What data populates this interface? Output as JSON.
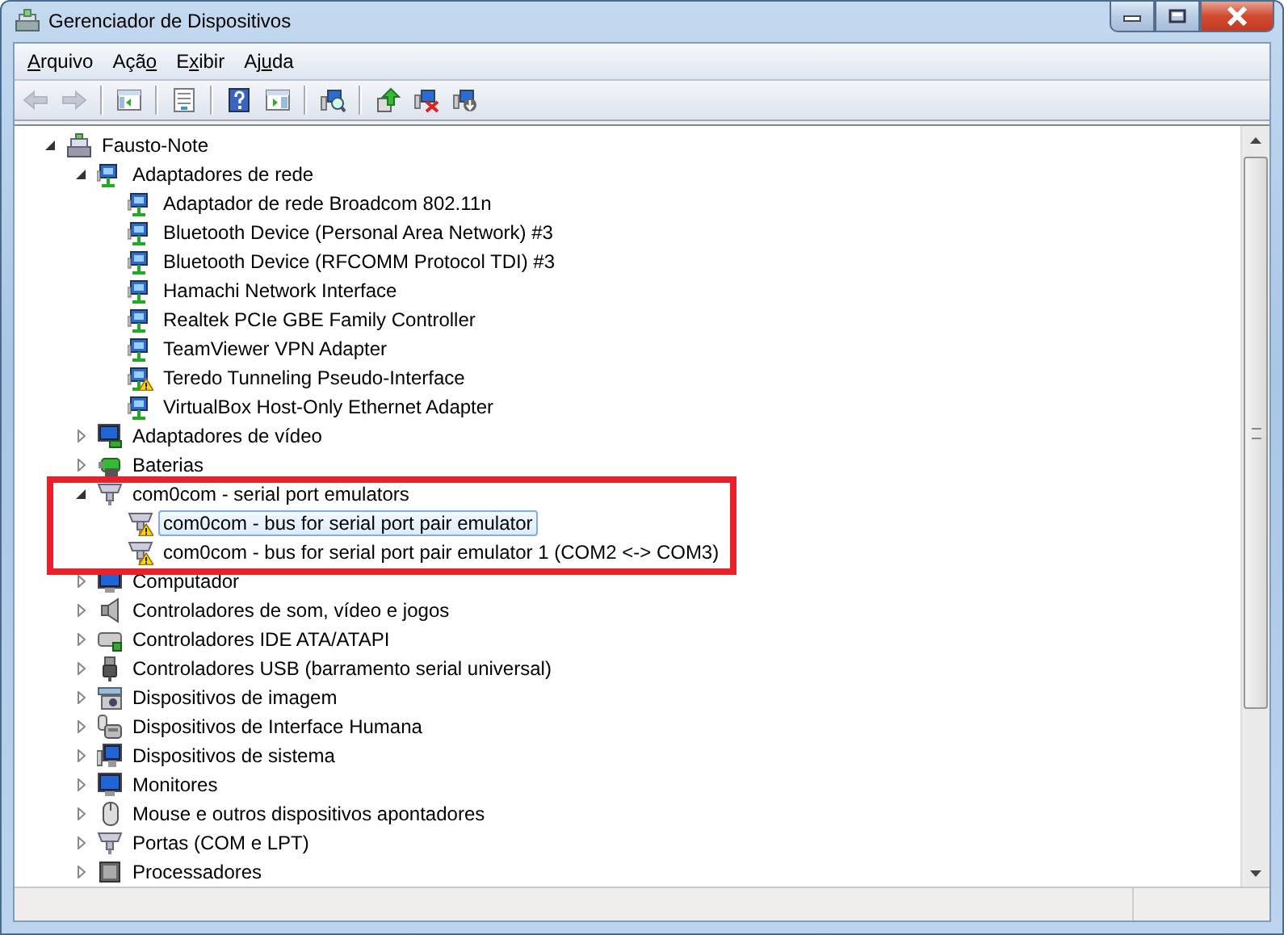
{
  "window": {
    "title": "Gerenciador de Dispositivos"
  },
  "menu": [
    {
      "key": "A",
      "post": "rquivo"
    },
    {
      "pre": "Açã",
      "key": "o"
    },
    {
      "pre": "E",
      "key": "x",
      "post": "ibir"
    },
    {
      "pre": "Aj",
      "key": "u",
      "post": "da"
    }
  ],
  "toolbar": [
    {
      "kind": "back",
      "disabled": true
    },
    {
      "kind": "forward",
      "disabled": true
    },
    {
      "kind": "separator"
    },
    {
      "kind": "tree-pane",
      "disabled": false
    },
    {
      "kind": "separator"
    },
    {
      "kind": "properties",
      "disabled": false
    },
    {
      "kind": "separator"
    },
    {
      "kind": "help",
      "disabled": false
    },
    {
      "kind": "action-pane",
      "disabled": false
    },
    {
      "kind": "separator"
    },
    {
      "kind": "scan",
      "disabled": false
    },
    {
      "kind": "separator"
    },
    {
      "kind": "update",
      "disabled": false
    },
    {
      "kind": "uninstall",
      "disabled": false
    },
    {
      "kind": "disable",
      "disabled": false
    }
  ],
  "tree": [
    {
      "label": "Fausto-Note",
      "kind": "computer",
      "expanded": true,
      "children": [
        {
          "label": "Adaptadores de rede",
          "kind": "network",
          "expanded": true,
          "children": [
            {
              "label": "Adaptador de rede Broadcom 802.11n",
              "kind": "network",
              "warning": false,
              "selected": false
            },
            {
              "label": "Bluetooth Device (Personal Area Network) #3",
              "kind": "network",
              "warning": false,
              "selected": false
            },
            {
              "label": "Bluetooth Device (RFCOMM Protocol TDI) #3",
              "kind": "network",
              "warning": false,
              "selected": false
            },
            {
              "label": "Hamachi Network Interface",
              "kind": "network",
              "warning": false,
              "selected": false
            },
            {
              "label": "Realtek PCIe GBE Family Controller",
              "kind": "network",
              "warning": false,
              "selected": false
            },
            {
              "label": "TeamViewer VPN Adapter",
              "kind": "network",
              "warning": false,
              "selected": false
            },
            {
              "label": "Teredo Tunneling Pseudo-Interface",
              "kind": "network",
              "warning": true,
              "selected": false
            },
            {
              "label": "VirtualBox Host-Only Ethernet Adapter",
              "kind": "network",
              "warning": false,
              "selected": false
            }
          ]
        },
        {
          "label": "Adaptadores de vídeo",
          "kind": "display",
          "expanded": false
        },
        {
          "label": "Baterias",
          "kind": "battery",
          "expanded": false
        },
        {
          "label": "com0com - serial port emulators",
          "kind": "port",
          "expanded": true,
          "highlighted": true,
          "children": [
            {
              "label": "com0com - bus for serial port pair emulator",
              "kind": "port",
              "warning": true,
              "selected": true
            },
            {
              "label": "com0com - bus for serial port pair emulator 1 (COM2 <-> COM3)",
              "kind": "port",
              "warning": true,
              "selected": false
            }
          ]
        },
        {
          "label": "Computador",
          "kind": "monitor",
          "expanded": false
        },
        {
          "label": "Controladores de som, vídeo e jogos",
          "kind": "sound",
          "expanded": false
        },
        {
          "label": "Controladores IDE ATA/ATAPI",
          "kind": "ide",
          "expanded": false
        },
        {
          "label": "Controladores USB (barramento serial universal)",
          "kind": "usb",
          "expanded": false
        },
        {
          "label": "Dispositivos de imagem",
          "kind": "imaging",
          "expanded": false
        },
        {
          "label": "Dispositivos de Interface Humana",
          "kind": "hid",
          "expanded": false
        },
        {
          "label": "Dispositivos de sistema",
          "kind": "system",
          "expanded": false
        },
        {
          "label": "Monitores",
          "kind": "monitor",
          "expanded": false
        },
        {
          "label": "Mouse e outros dispositivos apontadores",
          "kind": "mouse",
          "expanded": false
        },
        {
          "label": "Portas (COM e LPT)",
          "kind": "port",
          "expanded": false
        },
        {
          "label": "Processadores",
          "kind": "processor",
          "expanded": false
        }
      ]
    }
  ]
}
